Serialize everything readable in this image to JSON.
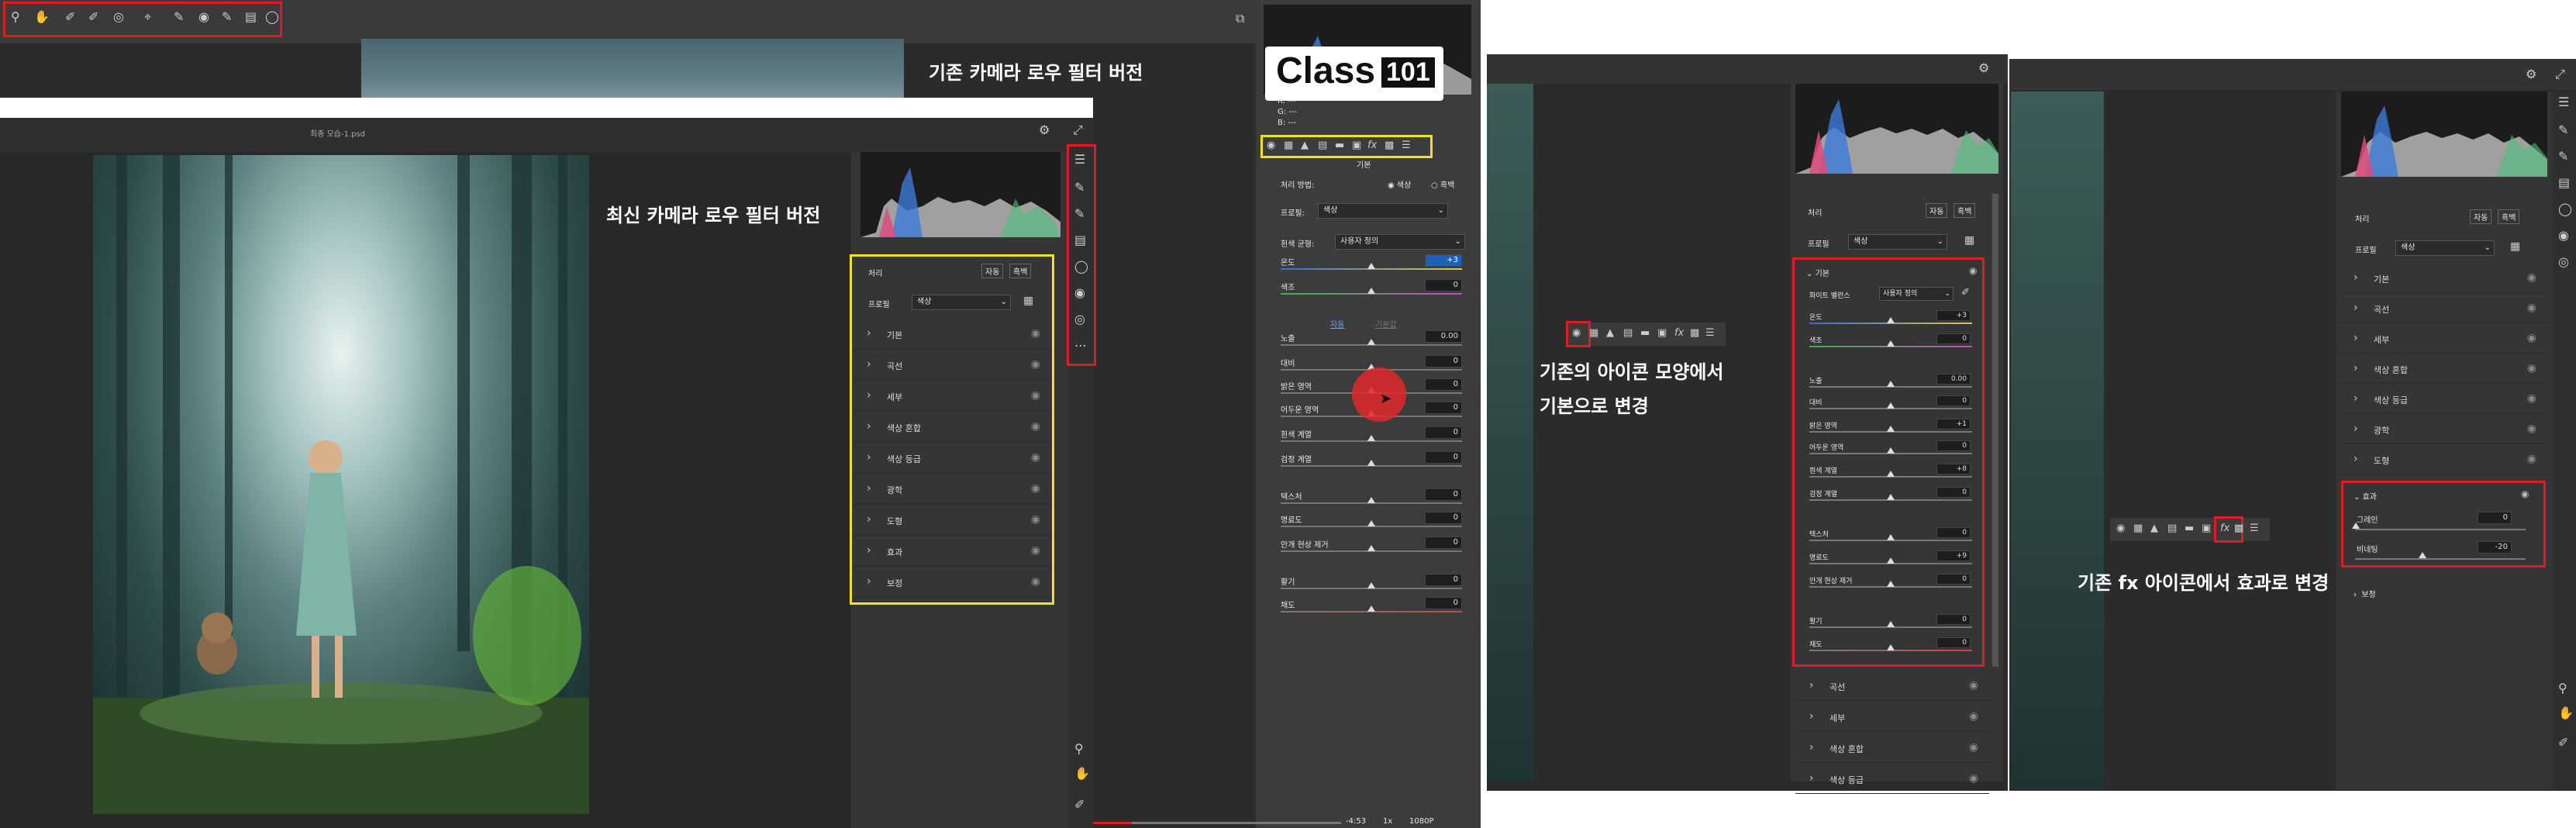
{
  "annotations": {
    "old_version": "기존 카메라 로우 필터 버전",
    "new_version": "최신 카메라 로우 필터 버전",
    "icon_change_line1": "기존의 아이콘 모양에서",
    "icon_change_line2": "기본으로 변경",
    "fx_change": "기존 fx 아이콘에서 효과로 변경"
  },
  "logo": {
    "text": "Class",
    "number": "101"
  },
  "new_panel": {
    "file_title": "최종 모습-1.psd",
    "profile_header": "처리",
    "auto": "자동",
    "bw": "흑백",
    "profile_label": "프로필",
    "profile_value": "색상",
    "sections": [
      "기본",
      "곡선",
      "세부",
      "색상 혼합",
      "색상 등급",
      "광학",
      "도형",
      "효과",
      "보정"
    ]
  },
  "old_panel": {
    "tab_title": "기본",
    "process_label": "처리 방법:",
    "color_option": "색상",
    "bw_option": "흑백",
    "profile_label": "프로필:",
    "profile_value": "색상",
    "wb_label": "흰색 균형:",
    "wb_value": "사용자 정의",
    "auto_link": "자동",
    "default_link": "기본값",
    "sliders": [
      {
        "label": "온도",
        "value": "+3"
      },
      {
        "label": "색조",
        "value": "0"
      },
      {
        "label": "노출",
        "value": "0.00"
      },
      {
        "label": "대비",
        "value": "0"
      },
      {
        "label": "밝은 영역",
        "value": "0"
      },
      {
        "label": "어두운 영역",
        "value": "0"
      },
      {
        "label": "흰색 계열",
        "value": "0"
      },
      {
        "label": "검정 계열",
        "value": "0"
      },
      {
        "label": "텍스처",
        "value": "0"
      },
      {
        "label": "명료도",
        "value": "0"
      },
      {
        "label": "안개 현상 제거",
        "value": "0"
      },
      {
        "label": "활기",
        "value": "0"
      },
      {
        "label": "채도",
        "value": "0"
      }
    ],
    "rgb": [
      "R:",
      "G:",
      "B:"
    ],
    "rgb_val": "---",
    "video_time": "-4:53",
    "video_speed": "1x",
    "video_quality": "1080P"
  },
  "mid_panel": {
    "header": "처리",
    "auto": "자동",
    "bw": "흑백",
    "profile_label": "프로필",
    "profile_value": "색상",
    "basic_title": "기본",
    "wb_label": "화이트 밸런스",
    "wb_value": "사용자 정의",
    "sliders": [
      {
        "label": "온도",
        "value": "+3"
      },
      {
        "label": "색조",
        "value": "0"
      },
      {
        "label": "노출",
        "value": "0.00"
      },
      {
        "label": "대비",
        "value": "0"
      },
      {
        "label": "밝은 영역",
        "value": "+1"
      },
      {
        "label": "어두운 영역",
        "value": "0"
      },
      {
        "label": "흰색 계열",
        "value": "+8"
      },
      {
        "label": "검정 계열",
        "value": "0"
      },
      {
        "label": "텍스처",
        "value": "0"
      },
      {
        "label": "명료도",
        "value": "+9"
      },
      {
        "label": "안개 현상 제거",
        "value": "0"
      },
      {
        "label": "활기",
        "value": "0"
      },
      {
        "label": "채도",
        "value": "0"
      }
    ],
    "more": [
      "곡선",
      "세부",
      "색상 혼합",
      "색상 등급"
    ]
  },
  "right_panel": {
    "header": "처리",
    "auto": "자동",
    "bw": "흑백",
    "profile_label": "프로필",
    "profile_value": "색상",
    "sections_top": [
      "기본",
      "곡선",
      "세부",
      "색상 혼합",
      "색상 등급",
      "광학",
      "도형"
    ],
    "effects_title": "효과",
    "grain_label": "그레인",
    "grain_value": "0",
    "vignette_label": "비네팅",
    "vignette_value": "-20",
    "after": "보정"
  }
}
